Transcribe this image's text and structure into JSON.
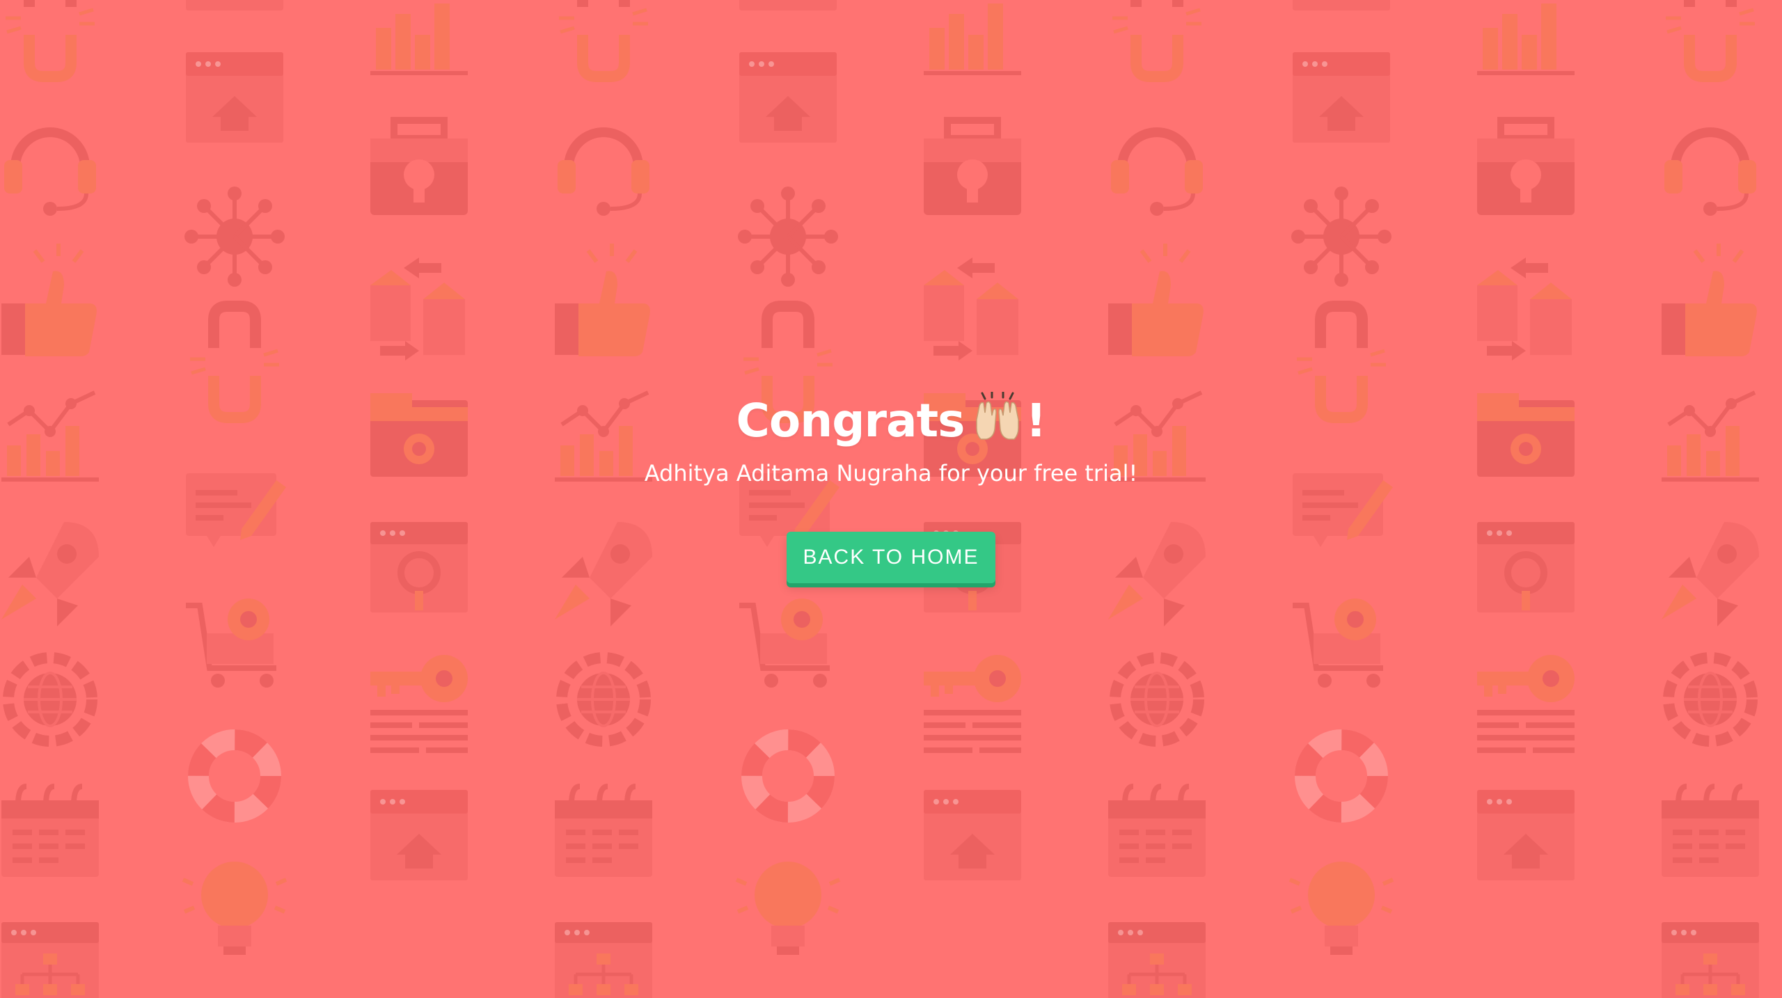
{
  "congrats": {
    "title_text": "Congrats",
    "exclamation": "!",
    "emoji_icon": "raising-hands-icon",
    "message": "Adhitya Aditama Nugraha for your free trial!"
  },
  "actions": {
    "back_home_label": "BACK TO HOME"
  },
  "colors": {
    "background": "#ff7372",
    "pattern": "#f25e5e",
    "button": "#34c886",
    "text": "#ffffff"
  }
}
